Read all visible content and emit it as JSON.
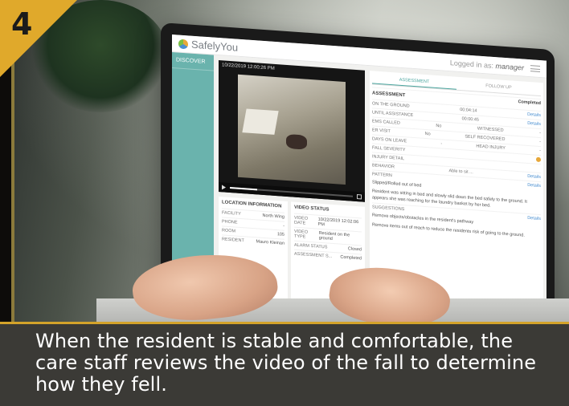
{
  "step_number": "4",
  "caption": "When the resident is stable and comfortable, the care staff reviews the video of the fall to determine how they fell.",
  "app": {
    "logo_text": "SafelyYou",
    "logged_in_prefix": "Logged in as:",
    "logged_in_user": "manager",
    "nav": [
      "DISCOVER"
    ],
    "video": {
      "timestamp": "10/22/2019 12:00:26 PM",
      "progress": 0.22
    },
    "location": {
      "title": "LOCATION INFORMATION",
      "rows": [
        {
          "k": "FACILITY",
          "v": "North Wing"
        },
        {
          "k": "PHONE",
          "v": "-"
        },
        {
          "k": "ROOM",
          "v": "105"
        },
        {
          "k": "RESIDENT",
          "v": "Mauro Kleinan"
        }
      ]
    },
    "video_status": {
      "title": "VIDEO STATUS",
      "rows": [
        {
          "k": "VIDEO DATE",
          "v": "10/22/2019 12:02:06 PM"
        },
        {
          "k": "VIDEO TYPE",
          "v": "Resident on the ground"
        },
        {
          "k": "ALARM STATUS",
          "v": "Closed"
        },
        {
          "k": "ASSESSMENT S...",
          "v": "Completed"
        }
      ]
    },
    "assessment": {
      "tabs": [
        "ASSESSMENT",
        "FOLLOW UP"
      ],
      "section": "ASSESSMENT",
      "status": "Completed",
      "rows": [
        {
          "k": "ON THE GROUND",
          "v": "00:04:14"
        },
        {
          "k": "UNTIL ASSISTANCE",
          "v": "00:00:45"
        },
        {
          "k": "EMS CALLED",
          "v": "No",
          "k2": "WITNESSED",
          "v2": "-"
        },
        {
          "k": "ER VISIT",
          "v": "No",
          "k2": "SELF RECOVERED",
          "v2": "-"
        },
        {
          "k": "DAYS ON LEAVE",
          "v": "-",
          "k2": "HEAD INJURY",
          "v2": "-"
        },
        {
          "k": "FALL SEVERITY",
          "v": ""
        },
        {
          "k": "INJURY DETAIL",
          "v": ""
        }
      ],
      "details_label": "Details",
      "behavior_label": "BEHAVIOR",
      "behavior_value": "Able to sit ...",
      "pattern_label": "PATTERN",
      "pattern_value": "Slipped/Rolled out of bed",
      "pattern_note": "Resident was sitting in bed and slowly slid down the bed safely to the ground. It appears she was reaching for the laundry basket by her bed.",
      "suggestions_label": "SUGGESTIONS",
      "suggestion": "Remove objects/obstacles in the resident's pathway",
      "suggestion2": "Remove items out of reach to reduce the residents risk of going to the ground."
    }
  },
  "colors": {
    "accent": "#e0a92b",
    "teal": "#6ab3ad",
    "caption_bg": "#3b3a36"
  }
}
